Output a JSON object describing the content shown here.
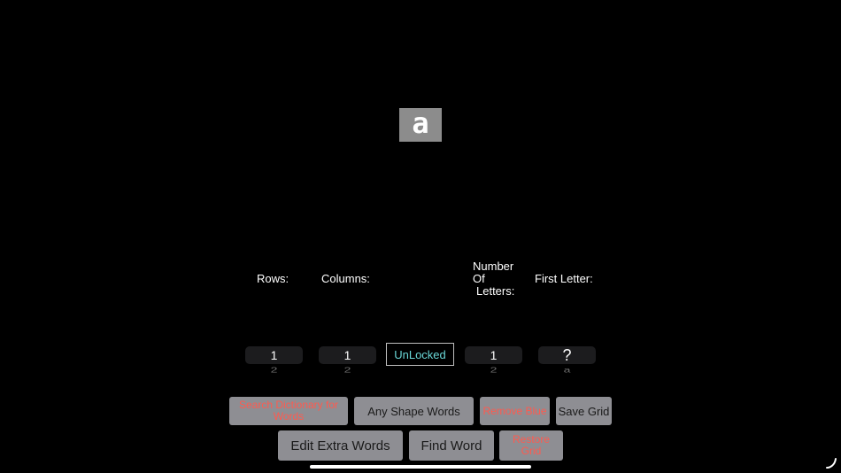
{
  "grid": {
    "cells": [
      "a"
    ]
  },
  "labels": {
    "rows": "Rows:",
    "columns": "Columns:",
    "number_of_letters_1": "Number",
    "number_of_letters_2": "Of",
    "number_of_letters_3": "Letters:",
    "first_letter": "First Letter:"
  },
  "pickers": {
    "rows": {
      "value": "1",
      "next": "2"
    },
    "columns": {
      "value": "1",
      "next": "2"
    },
    "letters": {
      "value": "1",
      "next": "2"
    },
    "first_letter": {
      "value": "?",
      "next": "a"
    }
  },
  "lock_toggle": "UnLocked",
  "buttons": {
    "search_dictionary": "Search Dictionary for Words",
    "any_shape_words": "Any Shape Words",
    "remove_blue": "Remove Blue",
    "save_grid": "Save Grid",
    "edit_extra_words": "Edit Extra Words",
    "find_word": "Find Word",
    "restore_grid": "Restore Grid"
  },
  "colors": {
    "background": "#000000",
    "button_gray": "#8e8e93",
    "disabled_red": "#ff5a4f",
    "lock_teal": "#69d6d6",
    "cell_gray": "#8c8c8c"
  },
  "icons": {
    "corner": "resize-handle-icon"
  }
}
